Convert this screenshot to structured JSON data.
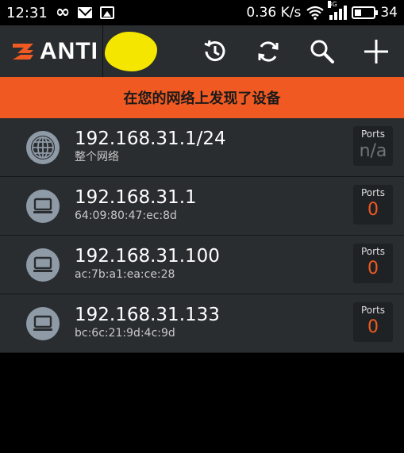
{
  "status_bar": {
    "time": "12:31",
    "infinity_symbol": "∞",
    "speed": "0.36 K/s",
    "network_type": "3G",
    "battery": "34",
    "battery_level": 0.34
  },
  "app_bar": {
    "brand_name": "ANTI",
    "actions": [
      {
        "icon": "history-icon"
      },
      {
        "icon": "refresh-icon"
      },
      {
        "icon": "search-icon"
      },
      {
        "icon": "add-icon"
      }
    ]
  },
  "banner": {
    "text": "在您的网络上发现了设备"
  },
  "colors": {
    "accent": "#f05a22",
    "toolbar_bg": "#2a2d30",
    "row_bg": "#2a2d30",
    "icon_bg": "#8e9aa6"
  },
  "devices": [
    {
      "ip": "192.168.31.1/24",
      "subtitle": "整个网络",
      "icon": "globe-icon",
      "ports_label": "Ports",
      "ports_value": "n/a"
    },
    {
      "ip": "192.168.31.1",
      "subtitle": "64:09:80:47:ec:8d",
      "icon": "computer-icon",
      "ports_label": "Ports",
      "ports_value": "0"
    },
    {
      "ip": "192.168.31.100",
      "subtitle": "ac:7b:a1:ea:ce:28",
      "icon": "computer-icon",
      "ports_label": "Ports",
      "ports_value": "0"
    },
    {
      "ip": "192.168.31.133",
      "subtitle": "bc:6c:21:9d:4c:9d",
      "icon": "computer-icon",
      "ports_label": "Ports",
      "ports_value": "0"
    }
  ]
}
